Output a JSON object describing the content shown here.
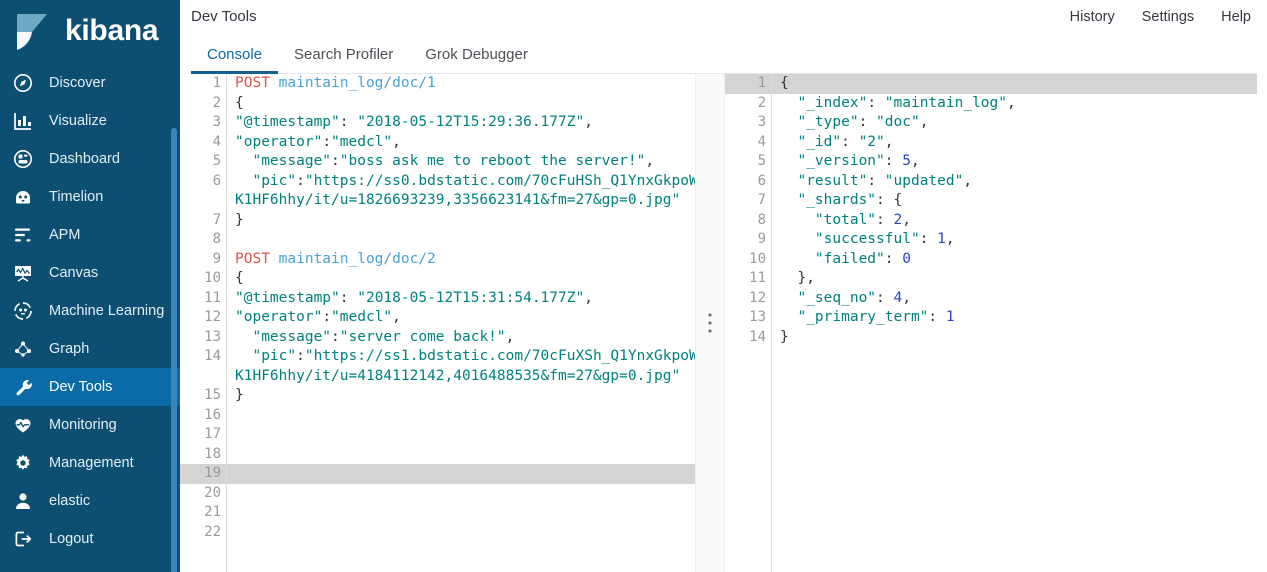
{
  "brand": {
    "name": "kibana",
    "logo_icon": "kibana-logo"
  },
  "sidebar": {
    "items": [
      {
        "label": "Discover",
        "icon": "compass-icon",
        "active": false
      },
      {
        "label": "Visualize",
        "icon": "bar-chart-icon",
        "active": false
      },
      {
        "label": "Dashboard",
        "icon": "dashboard-icon",
        "active": false
      },
      {
        "label": "Timelion",
        "icon": "timelion-icon",
        "active": false
      },
      {
        "label": "APM",
        "icon": "apm-icon",
        "active": false
      },
      {
        "label": "Canvas",
        "icon": "canvas-icon",
        "active": false
      },
      {
        "label": "Machine Learning",
        "icon": "ml-icon",
        "active": false
      },
      {
        "label": "Graph",
        "icon": "graph-icon",
        "active": false
      },
      {
        "label": "Dev Tools",
        "icon": "wrench-icon",
        "active": true
      },
      {
        "label": "Monitoring",
        "icon": "heartbeat-icon",
        "active": false
      },
      {
        "label": "Management",
        "icon": "gear-icon",
        "active": false
      },
      {
        "label": "elastic",
        "icon": "user-icon",
        "active": false
      },
      {
        "label": "Logout",
        "icon": "logout-icon",
        "active": false
      }
    ]
  },
  "header": {
    "title": "Dev Tools",
    "actions": [
      {
        "label": "History"
      },
      {
        "label": "Settings"
      },
      {
        "label": "Help"
      }
    ],
    "tabs": [
      {
        "label": "Console",
        "active": true
      },
      {
        "label": "Search Profiler",
        "active": false
      },
      {
        "label": "Grok Debugger",
        "active": false
      }
    ]
  },
  "console": {
    "request_editor": {
      "active_line": 19,
      "total_lines": 22,
      "lines": [
        {
          "n": 1,
          "fold": "",
          "tokens": [
            {
              "t": "method",
              "v": "POST"
            },
            {
              "t": "plain",
              "v": " "
            },
            {
              "t": "url",
              "v": "maintain_log/doc/1"
            }
          ]
        },
        {
          "n": 2,
          "fold": "▾",
          "tokens": [
            {
              "t": "punc",
              "v": "{"
            }
          ]
        },
        {
          "n": 3,
          "fold": "",
          "tokens": [
            {
              "t": "key",
              "v": "\"@timestamp\""
            },
            {
              "t": "punc",
              "v": ": "
            },
            {
              "t": "str",
              "v": "\"2018-05-12T15:29:36.177Z\""
            },
            {
              "t": "punc",
              "v": ","
            }
          ]
        },
        {
          "n": 4,
          "fold": "",
          "tokens": [
            {
              "t": "key",
              "v": "\"operator\""
            },
            {
              "t": "punc",
              "v": ":"
            },
            {
              "t": "str",
              "v": "\"medcl\""
            },
            {
              "t": "punc",
              "v": ","
            }
          ]
        },
        {
          "n": 5,
          "fold": "",
          "tokens": [
            {
              "t": "plain",
              "v": "  "
            },
            {
              "t": "key",
              "v": "\"message\""
            },
            {
              "t": "punc",
              "v": ":"
            },
            {
              "t": "str",
              "v": "\"boss ask me to reboot the server!\""
            },
            {
              "t": "punc",
              "v": ","
            }
          ]
        },
        {
          "n": 6,
          "fold": "",
          "tokens": [
            {
              "t": "plain",
              "v": "  "
            },
            {
              "t": "key",
              "v": "\"pic\""
            },
            {
              "t": "punc",
              "v": ":"
            },
            {
              "t": "str",
              "v": "\"https://ss0.bdstatic.com/70cFuHSh_Q1YnxGkpoW"
            }
          ]
        },
        {
          "n": "",
          "fold": "",
          "wrap": true,
          "tokens": [
            {
              "t": "str",
              "v": "K1HF6hhy/it/u=1826693239,3356623141&fm=27&gp=0.jpg\""
            }
          ]
        },
        {
          "n": 7,
          "fold": "▴",
          "tokens": [
            {
              "t": "punc",
              "v": "}"
            }
          ]
        },
        {
          "n": 8,
          "fold": "",
          "tokens": []
        },
        {
          "n": 9,
          "fold": "",
          "tokens": [
            {
              "t": "method",
              "v": "POST"
            },
            {
              "t": "plain",
              "v": " "
            },
            {
              "t": "url",
              "v": "maintain_log/doc/2"
            }
          ]
        },
        {
          "n": 10,
          "fold": "▾",
          "tokens": [
            {
              "t": "punc",
              "v": "{"
            }
          ]
        },
        {
          "n": 11,
          "fold": "",
          "tokens": [
            {
              "t": "key",
              "v": "\"@timestamp\""
            },
            {
              "t": "punc",
              "v": ": "
            },
            {
              "t": "str",
              "v": "\"2018-05-12T15:31:54.177Z\""
            },
            {
              "t": "punc",
              "v": ","
            }
          ]
        },
        {
          "n": 12,
          "fold": "",
          "tokens": [
            {
              "t": "key",
              "v": "\"operator\""
            },
            {
              "t": "punc",
              "v": ":"
            },
            {
              "t": "str",
              "v": "\"medcl\""
            },
            {
              "t": "punc",
              "v": ","
            }
          ]
        },
        {
          "n": 13,
          "fold": "",
          "tokens": [
            {
              "t": "plain",
              "v": "  "
            },
            {
              "t": "key",
              "v": "\"message\""
            },
            {
              "t": "punc",
              "v": ":"
            },
            {
              "t": "str",
              "v": "\"server come back!\""
            },
            {
              "t": "punc",
              "v": ","
            }
          ]
        },
        {
          "n": 14,
          "fold": "",
          "tokens": [
            {
              "t": "plain",
              "v": "  "
            },
            {
              "t": "key",
              "v": "\"pic\""
            },
            {
              "t": "punc",
              "v": ":"
            },
            {
              "t": "str",
              "v": "\"https://ss1.bdstatic.com/70cFuXSh_Q1YnxGkpoW"
            }
          ]
        },
        {
          "n": "",
          "fold": "",
          "wrap": true,
          "tokens": [
            {
              "t": "str",
              "v": "K1HF6hhy/it/u=4184112142,4016488535&fm=27&gp=0.jpg\""
            }
          ]
        },
        {
          "n": 15,
          "fold": "▴",
          "tokens": [
            {
              "t": "punc",
              "v": "}"
            }
          ]
        },
        {
          "n": 16,
          "fold": "",
          "tokens": []
        },
        {
          "n": 17,
          "fold": "",
          "tokens": []
        },
        {
          "n": 18,
          "fold": "",
          "tokens": []
        },
        {
          "n": 19,
          "fold": "",
          "active": true,
          "tokens": []
        },
        {
          "n": 20,
          "fold": "",
          "tokens": []
        },
        {
          "n": 21,
          "fold": "",
          "tokens": []
        },
        {
          "n": 22,
          "fold": "",
          "tokens": []
        }
      ]
    },
    "response_editor": {
      "active_line": 1,
      "total_lines": 14,
      "lines": [
        {
          "n": 1,
          "fold": "▾",
          "active": true,
          "tokens": [
            {
              "t": "punc",
              "v": "{"
            }
          ]
        },
        {
          "n": 2,
          "fold": "",
          "tokens": [
            {
              "t": "plain",
              "v": "  "
            },
            {
              "t": "key",
              "v": "\"_index\""
            },
            {
              "t": "punc",
              "v": ": "
            },
            {
              "t": "str",
              "v": "\"maintain_log\""
            },
            {
              "t": "punc",
              "v": ","
            }
          ]
        },
        {
          "n": 3,
          "fold": "",
          "tokens": [
            {
              "t": "plain",
              "v": "  "
            },
            {
              "t": "key",
              "v": "\"_type\""
            },
            {
              "t": "punc",
              "v": ": "
            },
            {
              "t": "str",
              "v": "\"doc\""
            },
            {
              "t": "punc",
              "v": ","
            }
          ]
        },
        {
          "n": 4,
          "fold": "",
          "tokens": [
            {
              "t": "plain",
              "v": "  "
            },
            {
              "t": "key",
              "v": "\"_id\""
            },
            {
              "t": "punc",
              "v": ": "
            },
            {
              "t": "str",
              "v": "\"2\""
            },
            {
              "t": "punc",
              "v": ","
            }
          ]
        },
        {
          "n": 5,
          "fold": "",
          "tokens": [
            {
              "t": "plain",
              "v": "  "
            },
            {
              "t": "key",
              "v": "\"_version\""
            },
            {
              "t": "punc",
              "v": ": "
            },
            {
              "t": "num",
              "v": "5"
            },
            {
              "t": "punc",
              "v": ","
            }
          ]
        },
        {
          "n": 6,
          "fold": "",
          "tokens": [
            {
              "t": "plain",
              "v": "  "
            },
            {
              "t": "key",
              "v": "\"result\""
            },
            {
              "t": "punc",
              "v": ": "
            },
            {
              "t": "str",
              "v": "\"updated\""
            },
            {
              "t": "punc",
              "v": ","
            }
          ]
        },
        {
          "n": 7,
          "fold": "▾",
          "tokens": [
            {
              "t": "plain",
              "v": "  "
            },
            {
              "t": "key",
              "v": "\"_shards\""
            },
            {
              "t": "punc",
              "v": ": {"
            }
          ]
        },
        {
          "n": 8,
          "fold": "",
          "tokens": [
            {
              "t": "plain",
              "v": "    "
            },
            {
              "t": "key",
              "v": "\"total\""
            },
            {
              "t": "punc",
              "v": ": "
            },
            {
              "t": "num",
              "v": "2"
            },
            {
              "t": "punc",
              "v": ","
            }
          ]
        },
        {
          "n": 9,
          "fold": "",
          "tokens": [
            {
              "t": "plain",
              "v": "    "
            },
            {
              "t": "key",
              "v": "\"successful\""
            },
            {
              "t": "punc",
              "v": ": "
            },
            {
              "t": "num",
              "v": "1"
            },
            {
              "t": "punc",
              "v": ","
            }
          ]
        },
        {
          "n": 10,
          "fold": "",
          "tokens": [
            {
              "t": "plain",
              "v": "    "
            },
            {
              "t": "key",
              "v": "\"failed\""
            },
            {
              "t": "punc",
              "v": ": "
            },
            {
              "t": "num",
              "v": "0"
            }
          ]
        },
        {
          "n": 11,
          "fold": "▴",
          "tokens": [
            {
              "t": "plain",
              "v": "  "
            },
            {
              "t": "punc",
              "v": "},"
            }
          ]
        },
        {
          "n": 12,
          "fold": "",
          "tokens": [
            {
              "t": "plain",
              "v": "  "
            },
            {
              "t": "key",
              "v": "\"_seq_no\""
            },
            {
              "t": "punc",
              "v": ": "
            },
            {
              "t": "num",
              "v": "4"
            },
            {
              "t": "punc",
              "v": ","
            }
          ]
        },
        {
          "n": 13,
          "fold": "",
          "tokens": [
            {
              "t": "plain",
              "v": "  "
            },
            {
              "t": "key",
              "v": "\"_primary_term\""
            },
            {
              "t": "punc",
              "v": ": "
            },
            {
              "t": "num",
              "v": "1"
            }
          ]
        },
        {
          "n": 14,
          "fold": "▴",
          "tokens": [
            {
              "t": "punc",
              "v": "}"
            }
          ]
        }
      ]
    },
    "splitter_icon": "drag-handle-icon"
  },
  "colors": {
    "sidebar_bg": "#0d4f72",
    "sidebar_active": "#0b6ba8",
    "accent_blue": "#0b6ba8",
    "tab_underline": "#16618f",
    "active_line": "#d4d4d4",
    "method": "#d9534f",
    "url": "#4aa3d4",
    "string": "#008080",
    "number": "#2d44c4"
  }
}
